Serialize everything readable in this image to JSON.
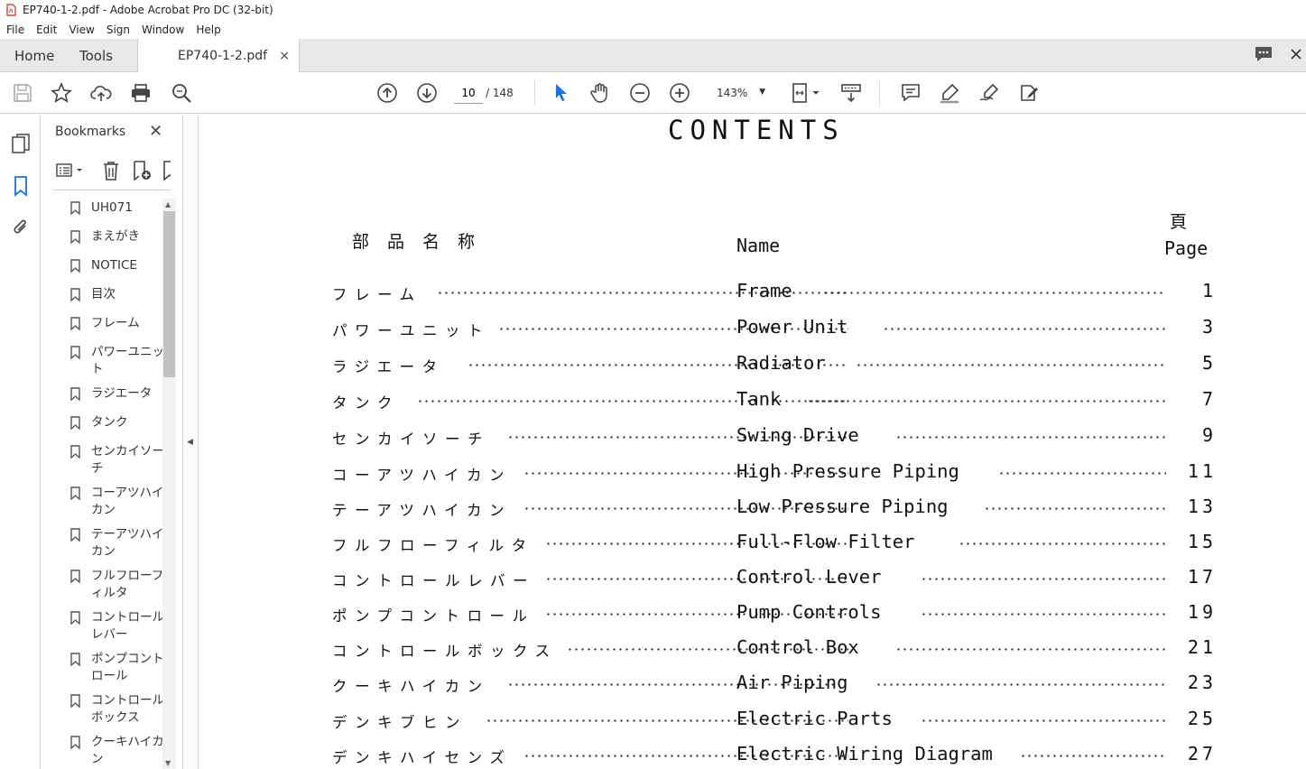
{
  "window": {
    "title": "EP740-1-2.pdf - Adobe Acrobat Pro DC (32-bit)"
  },
  "menu": [
    "File",
    "Edit",
    "View",
    "Sign",
    "Window",
    "Help"
  ],
  "tabs": {
    "home": "Home",
    "tools": "Tools",
    "document": "EP740-1-2.pdf",
    "close": "×"
  },
  "toolbar": {
    "page_current": "10",
    "page_total": "/ 148",
    "zoom": "143%",
    "icons": [
      "save-icon",
      "bookmark-star-icon",
      "upload-icon",
      "print-icon",
      "find-icon",
      "prev-page-icon",
      "next-page-icon",
      "select-cursor-icon",
      "hand-icon",
      "zoom-out-icon",
      "zoom-in-icon",
      "page-fit-icon",
      "scroll-mode-icon",
      "comment-icon",
      "highlight-icon",
      "sign-icon",
      "fill-sign-icon"
    ]
  },
  "bookmarks": {
    "header": "Bookmarks",
    "close": "✕",
    "items": [
      "UH071",
      "まえがき",
      "NOTICE",
      "目次",
      "フレーム",
      "パワーユニット",
      "ラジエータ",
      "タンク",
      "センカイソーチ",
      "コーアツハイカン",
      "テーアツハイカン",
      "フルフローフィルタ",
      "コントロールレバー",
      "ポンプコントロール",
      "コントロールボックス",
      "クーキハイカン"
    ]
  },
  "document": {
    "title": "CONTENTS",
    "header_jp": "部品名称",
    "header_name": "Name",
    "header_page_jp": "頁",
    "header_page": "Page",
    "rows": [
      {
        "jp": "フレーム",
        "en": "Frame",
        "page": "1"
      },
      {
        "jp": "パワーユニット",
        "en": "Power Unit",
        "page": "3"
      },
      {
        "jp": "ラジエータ",
        "en": "Radiator",
        "page": "5"
      },
      {
        "jp": "タンク",
        "en": "Tank",
        "page": "7"
      },
      {
        "jp": "センカイソーチ",
        "en": "Swing Drive",
        "page": "9"
      },
      {
        "jp": "コーアツハイカン",
        "en": "High Pressure Piping",
        "page": "11"
      },
      {
        "jp": "テーアツハイカン",
        "en": "Low Pressure Piping",
        "page": "13"
      },
      {
        "jp": "フルフローフィルタ",
        "en": "Full-Flow Filter",
        "page": "15"
      },
      {
        "jp": "コントロールレバー",
        "en": "Control Lever",
        "page": "17"
      },
      {
        "jp": "ポンプコントロール",
        "en": "Pump Controls",
        "page": "19"
      },
      {
        "jp": "コントロールボックス",
        "en": "Control Box",
        "page": "21"
      },
      {
        "jp": "クーキハイカン",
        "en": "Air Piping",
        "page": "23"
      },
      {
        "jp": "デンキブヒン",
        "en": "Electric Parts",
        "page": "25"
      },
      {
        "jp": "デンキハイセンズ",
        "en": "Electric Wiring Diagram",
        "page": "27"
      }
    ]
  }
}
